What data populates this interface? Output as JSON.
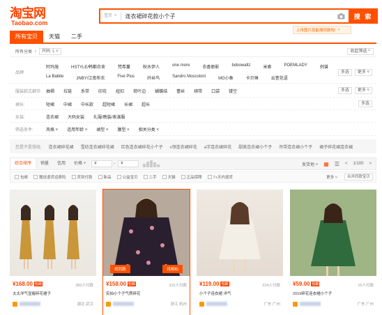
{
  "logo": {
    "main": "淘宝网",
    "sub": "Taobao.com"
  },
  "search": {
    "category": "宝贝",
    "query": "连衣裙碎花款小个子",
    "button": "搜 索",
    "tip": "上传图片就能搜同款啦!",
    "tip_close": "×"
  },
  "tabs": [
    "所有宝贝",
    "天猫",
    "二手"
  ],
  "crumb": {
    "all": "所有分类",
    "sep": "›",
    "chip": "尺码: L ×",
    "right": "收起筛选 ^"
  },
  "filters": [
    {
      "label": "品牌:",
      "values": [
        "阿玛施",
        "HSTYLE/韩都衣舍",
        "梵希蔓",
        "秋水伊人",
        "one more",
        "衣香丽影",
        "bobowaltz",
        "米索",
        "POEMLADY",
        "例谱",
        "La Babite",
        "JNBY/江南布衣",
        "Five Plus",
        "纤丝鸟",
        "Sandro Moscoloni",
        "MG小象",
        "卡贝琳",
        "云萱花语"
      ],
      "btns": [
        "多选",
        "更多 ˅"
      ]
    },
    {
      "label": "服装款式细节:",
      "values": [
        "抽褶",
        "拉链",
        "系带",
        "印花",
        "纽扣",
        "荷叶边",
        "蝴蝶结",
        "蕾丝",
        "绑带",
        "口袋",
        "镂空"
      ],
      "btns": [
        "多选",
        "更多 ˅"
      ]
    },
    {
      "label": "裙长:",
      "values": [
        "短裙",
        "中裙",
        "中长款",
        "超短裙",
        "长裙",
        "超长"
      ],
      "btns": [
        "多选"
      ]
    },
    {
      "label": "女装:",
      "values": [
        "连衣裙",
        "大码女装",
        "礼服/晚装/表演服"
      ],
      "btns": []
    },
    {
      "label": "筛选条件:",
      "values": [
        "风格 ˅",
        "适用年龄 ˅",
        "裙型 ˅",
        "腰型 ˅",
        "相关分类 ˅"
      ],
      "btns": []
    }
  ],
  "related": {
    "label": "您是不是想找:",
    "items": [
      "连衣裙碎花裙",
      "雪纺连衣裙碎花裙",
      "红色连衣裙碎花小个子",
      "v领连衣裙碎花",
      "a字连衣裙碎花",
      "甜美连衣裙小个子",
      "吊带连衣裙小个子",
      "裙子碎花裙连衣裙"
    ]
  },
  "sort": {
    "items": [
      "综合排序",
      "销量",
      "信用",
      "价格 ˅"
    ],
    "from": "¥",
    "to": "¥",
    "ship": "发货地 ˅",
    "page": "1/100",
    "prev": "<",
    "next": ">"
  },
  "options": {
    "items": [
      "包邮",
      "赠送退货运费险",
      "货到付款",
      "新品",
      "公益宝贝",
      "二手",
      "天猫",
      "正品保障",
      "7+天内退货"
    ],
    "more": "更多 ˅",
    "compare": "合并同款宝贝"
  },
  "products": [
    {
      "price": "¥168.00",
      "tag": "包邮",
      "sales": "383人付款",
      "title": "太太洋气显瘦碎花裙子",
      "loc": "湖北 武汉",
      "badges": []
    },
    {
      "price": "¥158.00",
      "tag": "包邮",
      "sales": "315人付款",
      "title": "实拍小个子气质碎花",
      "loc": "浙江 杭州",
      "badges": [
        "找同款",
        "找相似"
      ]
    },
    {
      "price": "¥119.00",
      "tag": "包邮",
      "sales": "224人付款",
      "title": "小个子连衣裙 洋气",
      "loc": "广东 广州",
      "badges": []
    },
    {
      "price": "¥59.00",
      "tag": "包邮",
      "sales": "15人付款",
      "title": "2019碎花连衣裙小个子",
      "loc": "广东 广州",
      "badges": []
    }
  ],
  "colors": {
    "accent": "#ff5000",
    "price": "#ff4400"
  }
}
